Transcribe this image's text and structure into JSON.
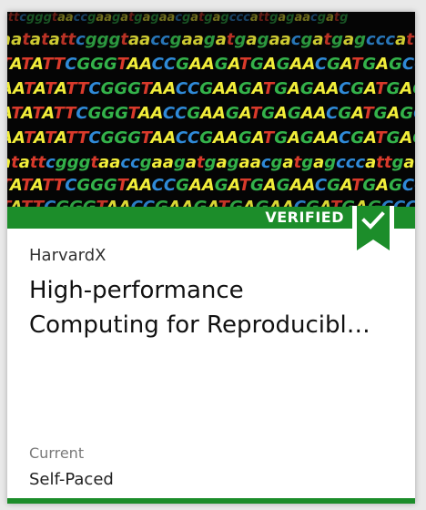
{
  "course": {
    "organization": "HarvardX",
    "title_line1": "High-performance",
    "title_line2": "Computing for Reproducibl…",
    "status": "Current",
    "pacing": "Self-Paced"
  },
  "badge": {
    "label": "VERIFIED",
    "icon": "checkmark-ribbon-icon"
  },
  "colors": {
    "brand_green": "#1c8d2a",
    "nucleotide_a": "#f2ee3a",
    "nucleotide_t": "#d93a2b",
    "nucleotide_c": "#2f8ad8",
    "nucleotide_g": "#33b24a"
  }
}
